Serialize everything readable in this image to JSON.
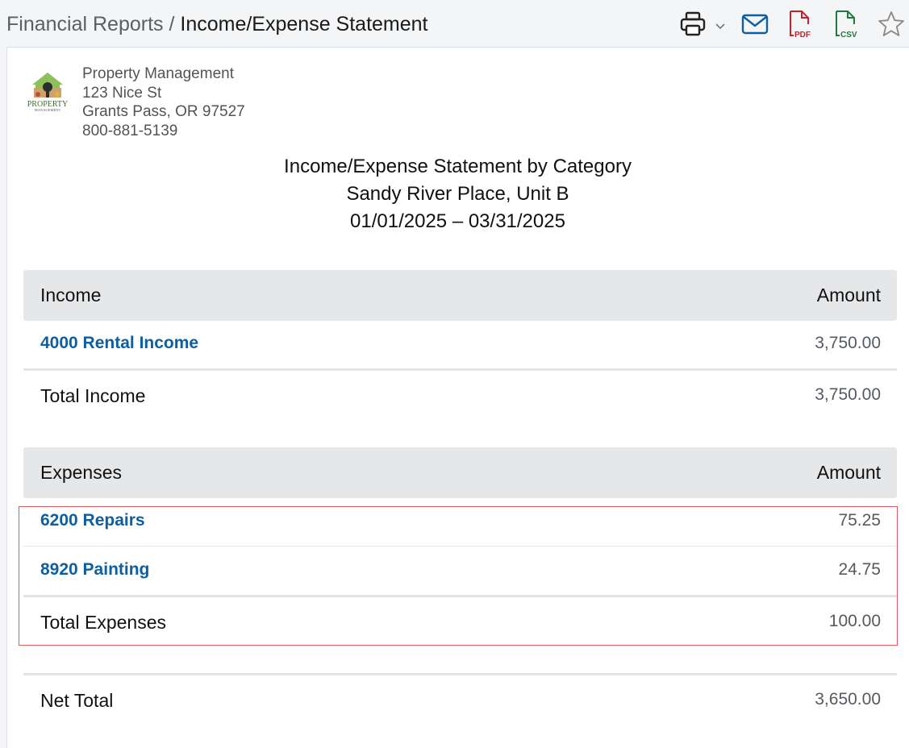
{
  "breadcrumb": {
    "parent": "Financial Reports",
    "separator": " / ",
    "current": "Income/Expense Statement"
  },
  "toolbar": {
    "icons": [
      "printer-icon",
      "chevron-down-icon",
      "email-icon",
      "pdf-icon",
      "csv-icon",
      "star-icon"
    ],
    "pdf_label": "PDF",
    "csv_label": "CSV"
  },
  "company": {
    "name": "Property Management",
    "address1": "123 Nice St",
    "address2": "Grants Pass, OR 97527",
    "phone": "800-881-5139",
    "logo_text": "PROPERTY",
    "logo_subtext": "MANAGEMENT"
  },
  "report": {
    "title": "Income/Expense Statement by Category",
    "property": "Sandy River Place, Unit B",
    "period": "01/01/2025 – 03/31/2025"
  },
  "income": {
    "header": "Income",
    "amount_header": "Amount",
    "rows": [
      {
        "label": "4000 Rental Income",
        "amount": "3,750.00"
      }
    ],
    "total_label": "Total Income",
    "total_amount": "3,750.00"
  },
  "expenses": {
    "header": "Expenses",
    "amount_header": "Amount",
    "rows": [
      {
        "label": "6200 Repairs",
        "amount": "75.25"
      },
      {
        "label": "8920 Painting",
        "amount": "24.75"
      }
    ],
    "total_label": "Total Expenses",
    "total_amount": "100.00"
  },
  "net": {
    "label": "Net Total",
    "amount": "3,650.00"
  },
  "colors": {
    "link": "#0d5fa0",
    "email_icon": "#0d5fa0",
    "pdf_icon": "#c8202e",
    "csv_icon": "#1e7a3c",
    "highlight_border": "#e05a63",
    "section_header_bg": "#e6e7e9"
  }
}
